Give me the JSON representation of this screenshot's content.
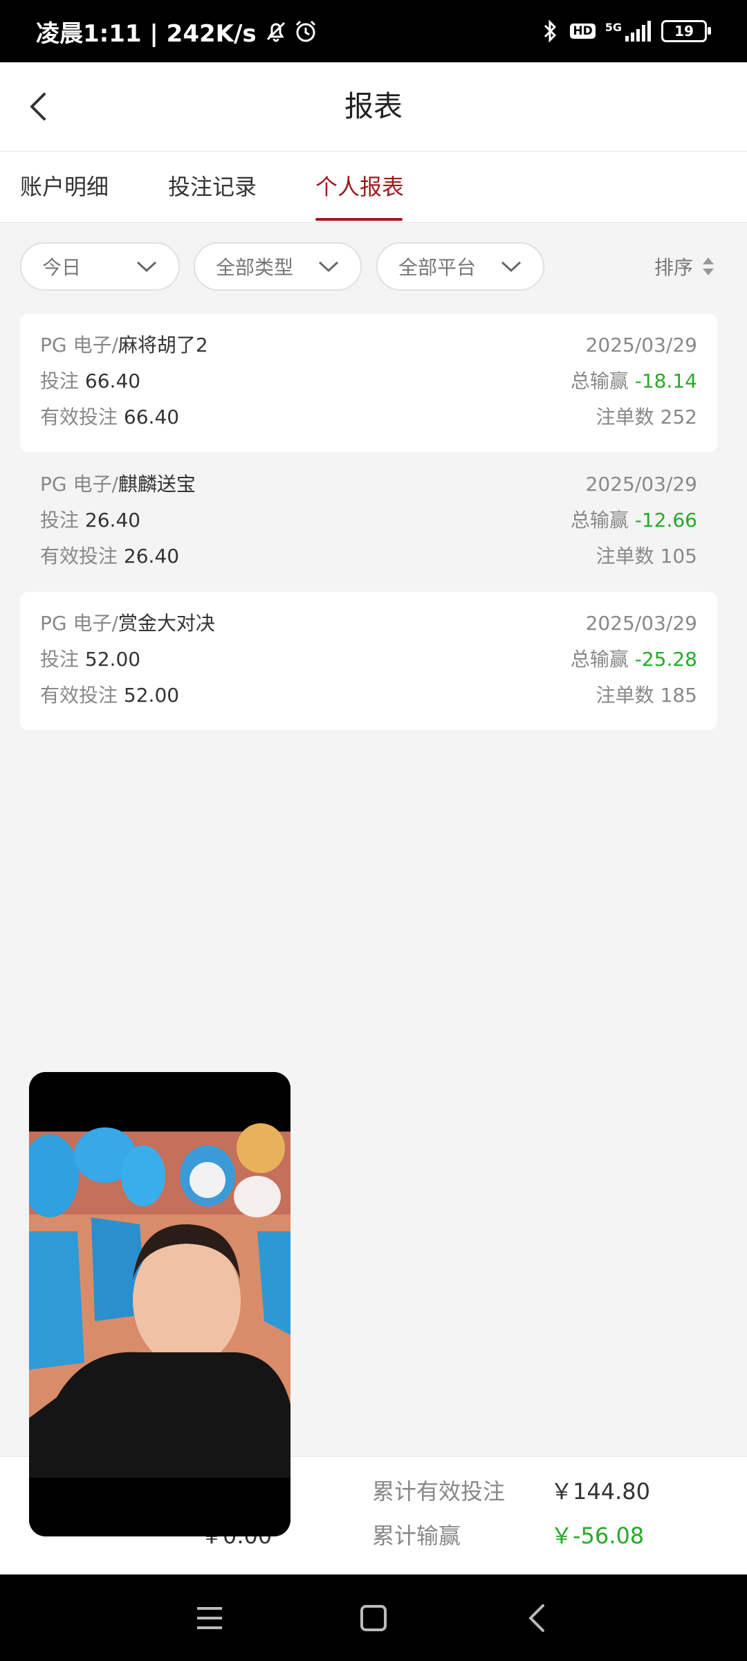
{
  "status": {
    "time_speed": "凌晨1:11 | 242K/s",
    "signal_label": "5G",
    "hd_label": "HD",
    "battery": "19"
  },
  "header": {
    "title": "报表"
  },
  "tabs": [
    {
      "label": "账户明细",
      "active": false
    },
    {
      "label": "投注记录",
      "active": false
    },
    {
      "label": "个人报表",
      "active": true
    }
  ],
  "filters": {
    "period": "今日",
    "type": "全部类型",
    "platform": "全部平台",
    "sort": "排序"
  },
  "records": [
    {
      "platform": "PG 电子/",
      "game": "麻将胡了2",
      "date": "2025/03/29",
      "bet_label": "投注",
      "bet": "66.40",
      "winloss_label": "总输赢",
      "winloss": "-18.14",
      "valid_label": "有效投注",
      "valid": "66.40",
      "count_label": "注单数",
      "count": "252"
    },
    {
      "platform": "PG 电子/",
      "game": "麒麟送宝",
      "date": "2025/03/29",
      "bet_label": "投注",
      "bet": "26.40",
      "winloss_label": "总输赢",
      "winloss": "-12.66",
      "valid_label": "有效投注",
      "valid": "26.40",
      "count_label": "注单数",
      "count": "105"
    },
    {
      "platform": "PG 电子/",
      "game": "赏金大对决",
      "date": "2025/03/29",
      "bet_label": "投注",
      "bet": "52.00",
      "winloss_label": "总输赢",
      "winloss": "-25.28",
      "valid_label": "有效投注",
      "valid": "52.00",
      "count_label": "注单数",
      "count": "185"
    }
  ],
  "summary": {
    "valid_bet_label": "累计有效投注",
    "valid_bet": "￥144.80",
    "winloss_label": "累计输赢",
    "winloss": "￥-56.08",
    "rebate_value": "￥0.00"
  },
  "colors": {
    "accent": "#9b1b1f",
    "loss_green": "#27a927"
  }
}
